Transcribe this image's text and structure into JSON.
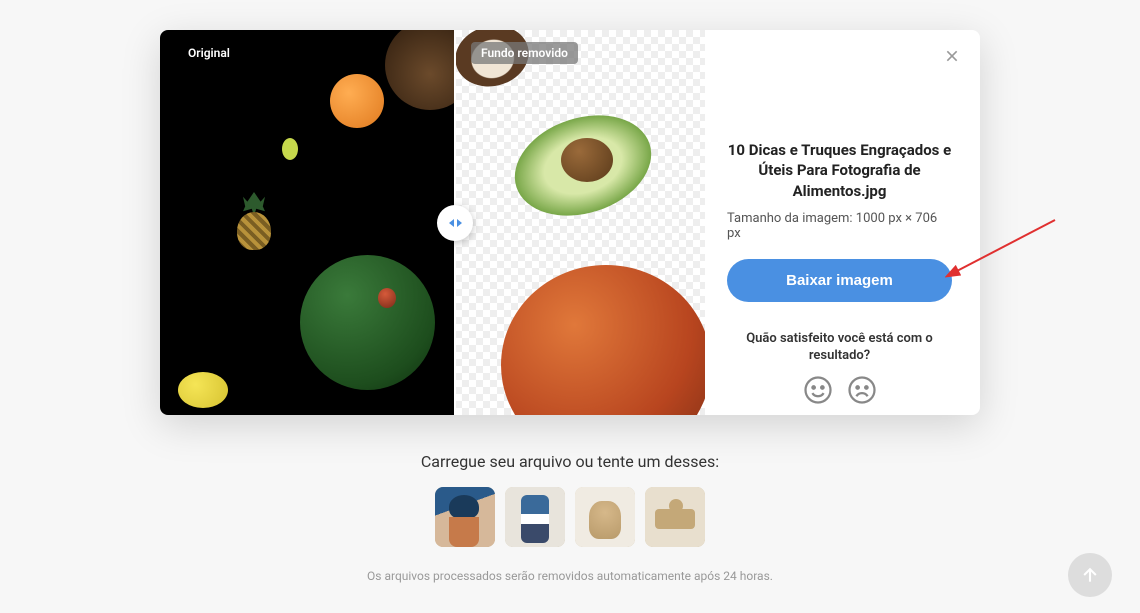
{
  "modal": {
    "original_badge": "Original",
    "removed_badge": "Fundo removido",
    "close_icon": "close-icon",
    "title": "10 Dicas e Truques Engraçados e Úteis Para Fotografia de Alimentos.jpg",
    "size_label": "Tamanho da imagem: 1000 px × 706 px",
    "download_button": "Baixar imagem",
    "satisfaction_question": "Quão satisfeito você está com o resultado?",
    "happy_icon": "happy-face-icon",
    "sad_icon": "sad-face-icon"
  },
  "page": {
    "upload_prompt": "Carregue seu arquivo ou tente um desses:",
    "auto_delete_note": "Os arquivos processados serão removidos automaticamente após 24 horas.",
    "scroll_top_icon": "arrow-up-icon"
  },
  "sample_thumbs": [
    {
      "name": "sample-1"
    },
    {
      "name": "sample-2"
    },
    {
      "name": "sample-3"
    },
    {
      "name": "sample-4"
    }
  ]
}
